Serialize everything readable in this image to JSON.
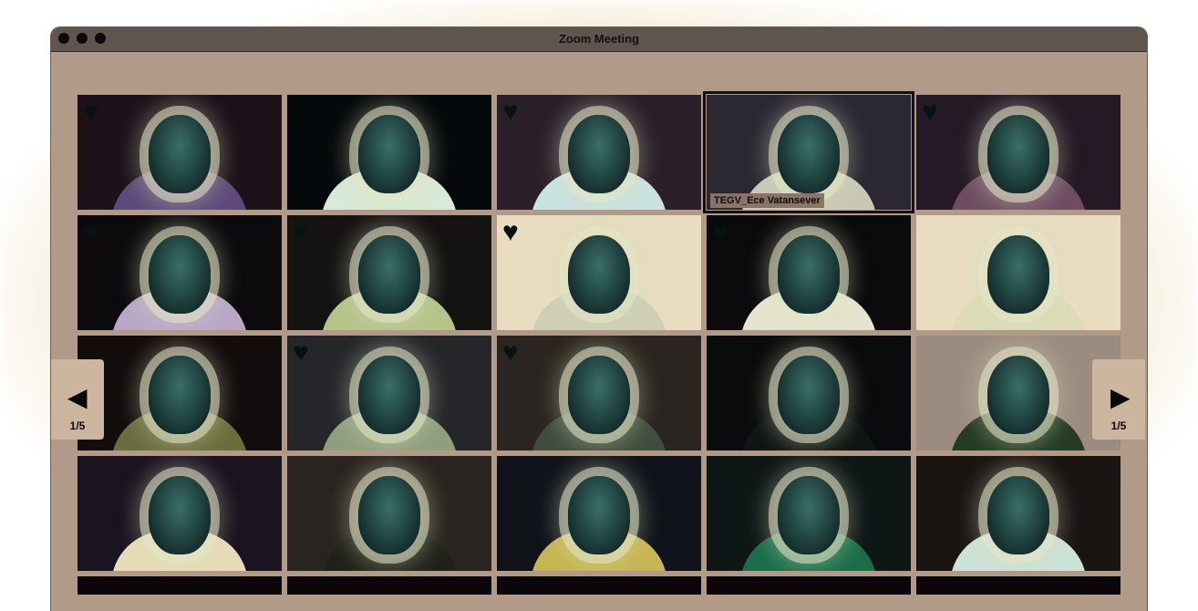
{
  "window": {
    "title": "Zoom Meeting"
  },
  "pagination": {
    "prev_label": "1/5",
    "next_label": "1/5"
  },
  "colors": {
    "window_bg": "#b19b88",
    "titlebar": "#5f544e",
    "tile_bg": "#0a0609",
    "glow": "#e9d8ad"
  },
  "participants": [
    {
      "name": "",
      "heart": true,
      "active": false,
      "body": "#5e4a7a",
      "bg": "#1d121a"
    },
    {
      "name": "",
      "heart": false,
      "active": false,
      "body": "#d9ead8",
      "bg": "#06090b"
    },
    {
      "name": "",
      "heart": true,
      "active": false,
      "body": "#c9e4e0",
      "bg": "#2b1f2a"
    },
    {
      "name": "TEGV_Ece Vatansever",
      "heart": false,
      "active": true,
      "body": "#c8c9b3",
      "bg": "#2b2733"
    },
    {
      "name": "",
      "heart": true,
      "active": false,
      "body": "#6f4c62",
      "bg": "#241925"
    },
    {
      "name": "",
      "heart": true,
      "active": false,
      "body": "#b9a6c8",
      "bg": "#0c0a0d"
    },
    {
      "name": "",
      "heart": true,
      "active": false,
      "body": "#b6c48a",
      "bg": "#151312"
    },
    {
      "name": "",
      "heart": true,
      "active": false,
      "body": "#cfcfb5",
      "bg": "#e8dcc1"
    },
    {
      "name": "",
      "heart": true,
      "active": false,
      "body": "#e5e5cf",
      "bg": "#0b0a0c"
    },
    {
      "name": "",
      "heart": false,
      "active": false,
      "body": "#dedcb8",
      "bg": "#e9dcc1"
    },
    {
      "name": "",
      "heart": false,
      "active": false,
      "body": "#6a6d3c",
      "bg": "#120c0c"
    },
    {
      "name": "",
      "heart": true,
      "active": false,
      "body": "#8f9f7e",
      "bg": "#24262a"
    },
    {
      "name": "",
      "heart": true,
      "active": false,
      "body": "#3f4e3d",
      "bg": "#2a2520"
    },
    {
      "name": "",
      "heart": false,
      "active": false,
      "body": "#0f1414",
      "bg": "#0a0b0c"
    },
    {
      "name": "",
      "heart": false,
      "active": false,
      "body": "#253b25",
      "bg": "#9c8c80"
    },
    {
      "name": "",
      "heart": false,
      "active": false,
      "body": "#e8dcb8",
      "bg": "#1a1320"
    },
    {
      "name": "",
      "heart": false,
      "active": false,
      "body": "#1f2219",
      "bg": "#2a2420"
    },
    {
      "name": "",
      "heart": false,
      "active": false,
      "body": "#c7b552",
      "bg": "#10141a"
    },
    {
      "name": "",
      "heart": false,
      "active": false,
      "body": "#1a6d4a",
      "bg": "#0f1616"
    },
    {
      "name": "",
      "heart": false,
      "active": false,
      "body": "#cde2d8",
      "bg": "#1a1413"
    }
  ]
}
